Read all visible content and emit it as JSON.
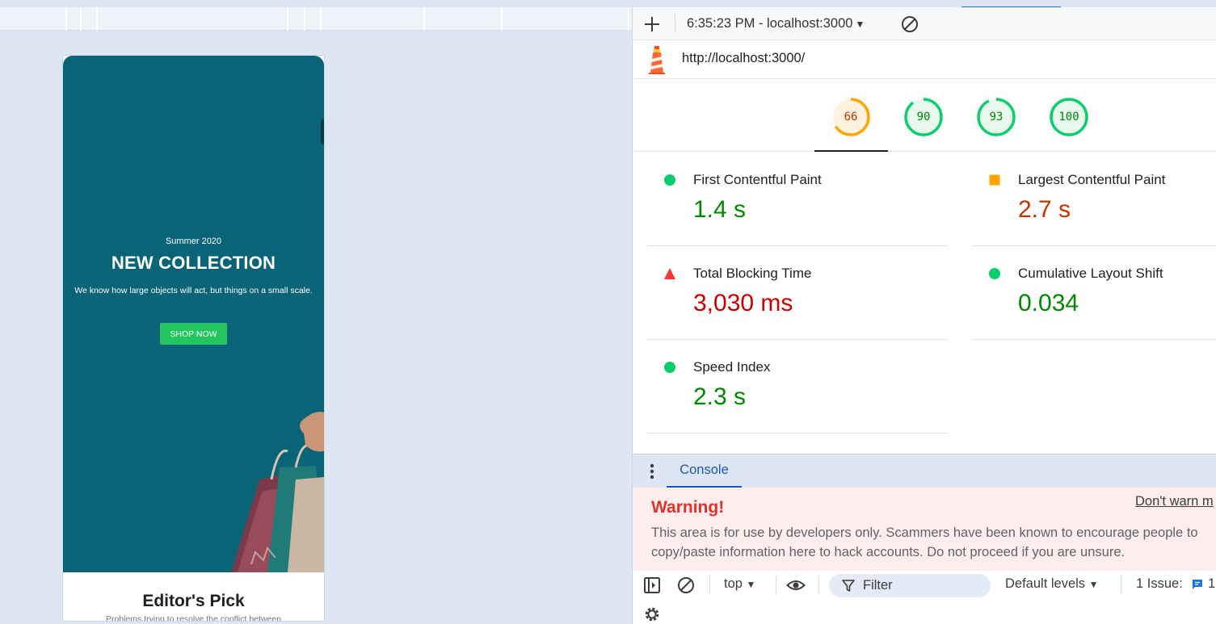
{
  "page": {
    "hero": {
      "subtitle": "Summer 2020",
      "title": "NEW COLLECTION",
      "description": "We know how large objects will act, but things on a small scale.",
      "button_label": "SHOP NOW"
    },
    "editors_pick": {
      "title": "Editor's Pick",
      "description": "Problems trying to resolve the conflict between"
    }
  },
  "devtools": {
    "report_select": {
      "label": "6:35:23 PM - localhost:3000"
    },
    "url": "http://localhost:3000/",
    "gauges": [
      {
        "score": "66",
        "status": "average",
        "color": "#c33300",
        "ring": "#ffa400",
        "fill": "#fff3e0",
        "fraction": 0.66
      },
      {
        "score": "90",
        "status": "pass",
        "color": "#008800",
        "ring": "#0cce6b",
        "fill": "#e8f8ee",
        "fraction": 0.9
      },
      {
        "score": "93",
        "status": "pass",
        "color": "#008800",
        "ring": "#0cce6b",
        "fill": "#e8f8ee",
        "fraction": 0.93
      },
      {
        "score": "100",
        "status": "pass",
        "color": "#008800",
        "ring": "#0cce6b",
        "fill": "#e8f8ee",
        "fraction": 1.0
      }
    ],
    "metrics": [
      {
        "title": "First Contentful Paint",
        "value": "1.4 s",
        "status": "pass",
        "color": "#008800"
      },
      {
        "title": "Largest Contentful Paint",
        "value": "2.7 s",
        "status": "average",
        "color": "#c33300"
      },
      {
        "title": "Total Blocking Time",
        "value": "3,030 ms",
        "status": "fail",
        "color": "#cc0000"
      },
      {
        "title": "Cumulative Layout Shift",
        "value": "0.034",
        "status": "pass",
        "color": "#008800"
      },
      {
        "title": "Speed Index",
        "value": "2.3 s",
        "status": "pass",
        "color": "#008800"
      }
    ],
    "drawer": {
      "tab_label": "Console"
    },
    "warning": {
      "title": "Warning!",
      "dont_warn": "Don't warn m",
      "body": "This area is for use by developers only. Scammers have been known to encourage people to copy/paste information here to hack accounts. Do not proceed if you are unsure."
    },
    "console_toolbar": {
      "context": "top",
      "filter_placeholder": "Filter",
      "levels": "Default levels",
      "issues_label": "1 Issue:",
      "issues_count": "1"
    }
  },
  "colors": {
    "pass": "#0cce6b",
    "average": "#ffa400",
    "fail": "#ff3333",
    "accent": "#1a56c5",
    "hero_bg": "#0a6478",
    "shop_button": "#22c55e"
  }
}
